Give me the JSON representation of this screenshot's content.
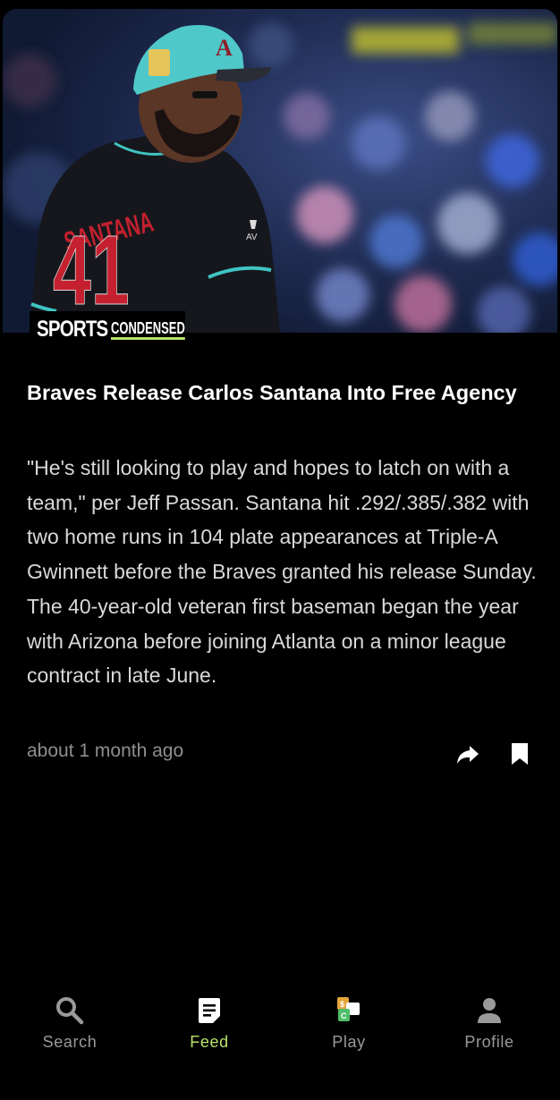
{
  "article": {
    "image_caption_brand": {
      "part1": "SPORTS",
      "part2": "CONDENSED"
    },
    "jersey_name": "SANTANA",
    "jersey_number": "41",
    "headline": "Braves Release Carlos Santana Into Free Agency",
    "body": "\"He's still looking to play and hopes to latch on with a team,\" per Jeff Passan. Santana hit .292/.385/.382 with two home runs in 104 plate appearances at Triple-A Gwinnett before the Braves granted his release Sunday. The 40-year-old veteran first baseman began the year with Arizona before joining Atlanta on a minor league contract in late June.",
    "timestamp": "about 1 month ago",
    "actions": {
      "share_icon": "share-arrow-icon",
      "bookmark_icon": "bookmark-icon"
    }
  },
  "tabbar": {
    "tabs": [
      {
        "label": "Search",
        "icon": "search-icon",
        "active": false
      },
      {
        "label": "Feed",
        "icon": "feed-document-icon",
        "active": true
      },
      {
        "label": "Play",
        "icon": "play-cards-icon",
        "active": false
      },
      {
        "label": "Profile",
        "icon": "profile-person-icon",
        "active": false
      }
    ]
  },
  "colors": {
    "accent": "#b7e26a",
    "background": "#000000",
    "muted_text": "#8e8e8e",
    "body_text": "#d9d9d9"
  }
}
